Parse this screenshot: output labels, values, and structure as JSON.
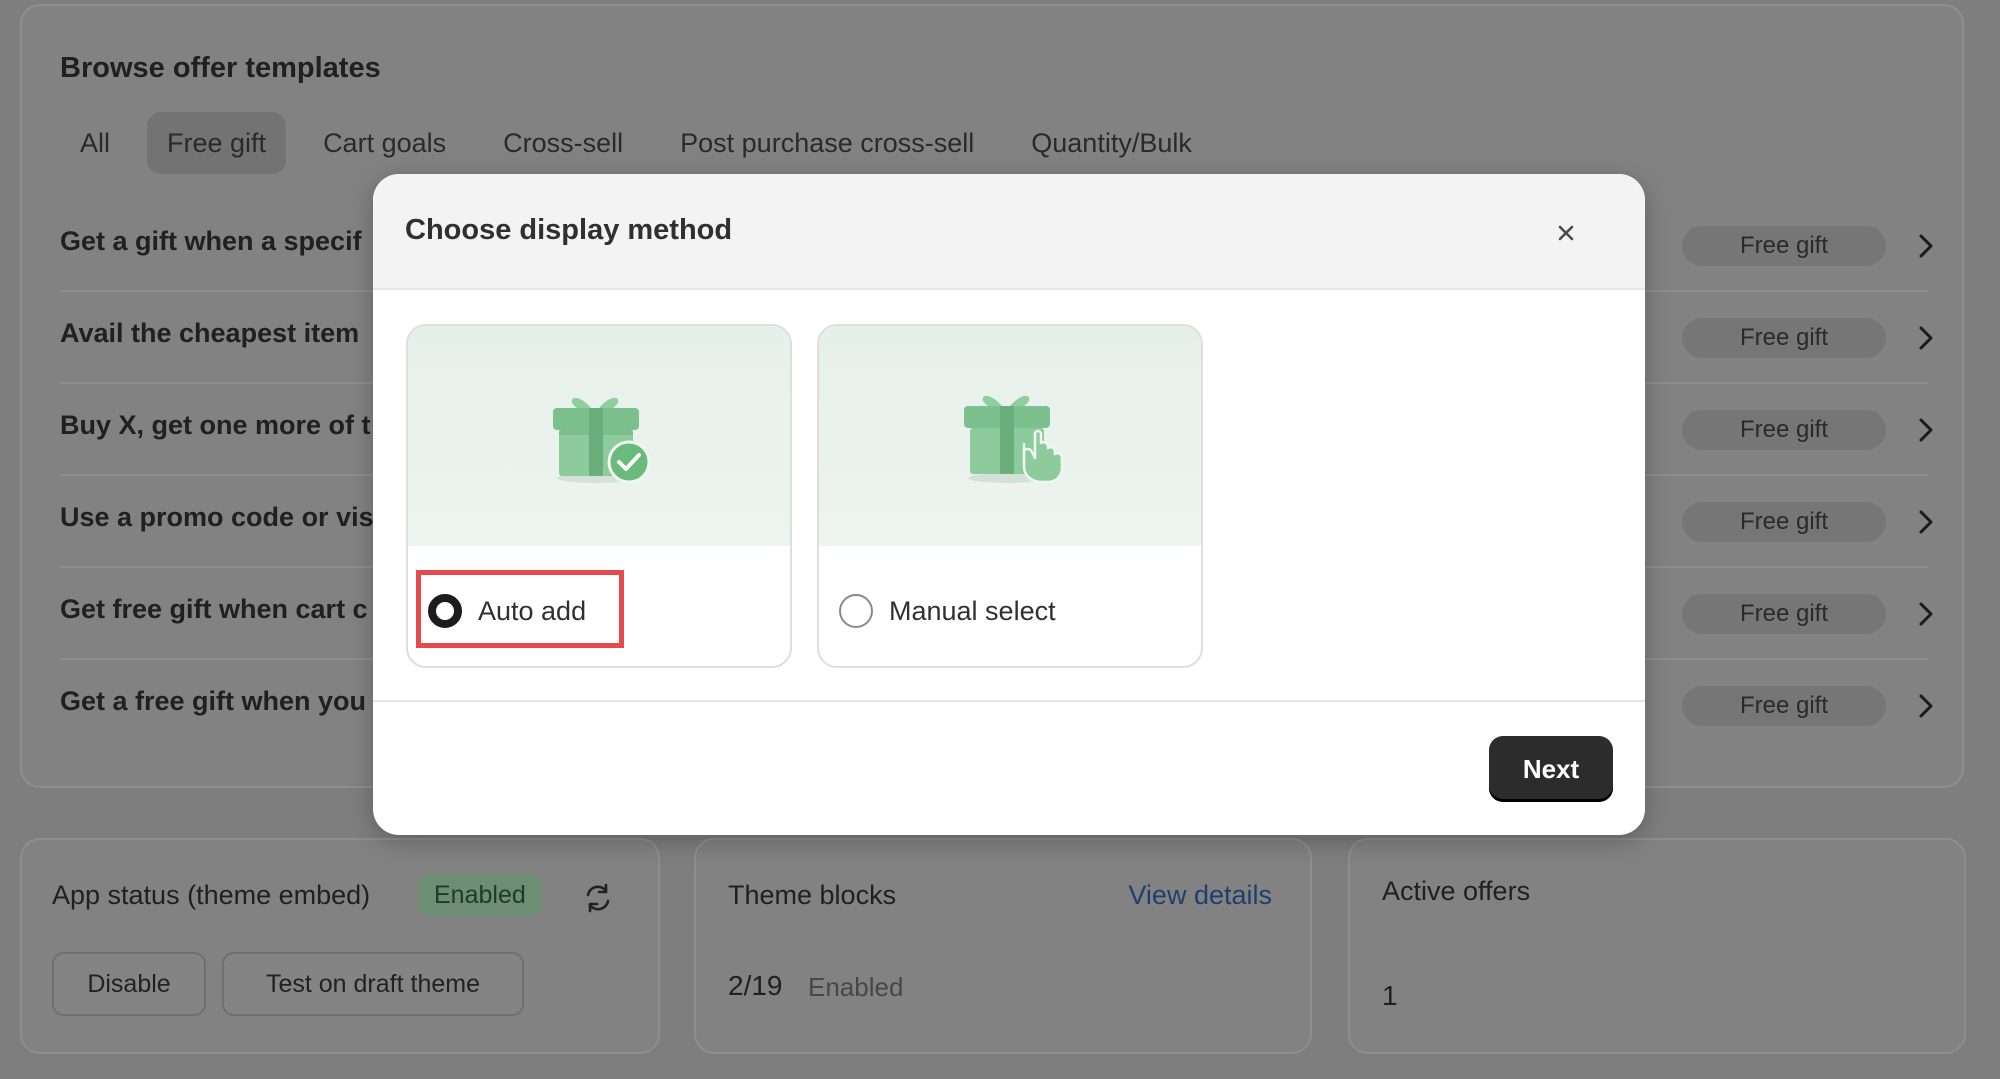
{
  "templates": {
    "title": "Browse offer templates",
    "tabs": [
      {
        "label": "All",
        "active": false
      },
      {
        "label": "Free gift",
        "active": true
      },
      {
        "label": "Cart goals",
        "active": false
      },
      {
        "label": "Cross-sell",
        "active": false
      },
      {
        "label": "Post purchase cross-sell",
        "active": false
      },
      {
        "label": "Quantity/Bulk",
        "active": false
      }
    ],
    "rows": [
      {
        "title": "Get a gift when a specif",
        "badge": "Free gift"
      },
      {
        "title": "Avail the cheapest item",
        "badge": "Free gift"
      },
      {
        "title": "Buy X, get one more of t",
        "badge": "Free gift"
      },
      {
        "title": "Use a promo code or vis",
        "badge": "Free gift"
      },
      {
        "title": "Get free gift when cart c",
        "badge": "Free gift"
      },
      {
        "title": "Get a free gift when you",
        "badge": "Free gift"
      }
    ]
  },
  "app_status": {
    "title": "App status (theme embed)",
    "badge": "Enabled",
    "disable_label": "Disable",
    "test_label": "Test on draft theme"
  },
  "theme_blocks": {
    "title": "Theme blocks",
    "link": "View details",
    "count": "2/19",
    "count_label": "Enabled"
  },
  "active_offers": {
    "title": "Active offers",
    "count": "1"
  },
  "modal": {
    "title": "Choose display method",
    "options": [
      {
        "label": "Auto add",
        "selected": true,
        "icon": "gift-check-icon"
      },
      {
        "label": "Manual select",
        "selected": false,
        "icon": "gift-pointer-icon"
      }
    ],
    "next_label": "Next"
  },
  "colors": {
    "highlight": "#e5484d",
    "gift_green": "#7cc08e",
    "primary_button": "#2c2c2c",
    "link": "#1e3f6e"
  }
}
